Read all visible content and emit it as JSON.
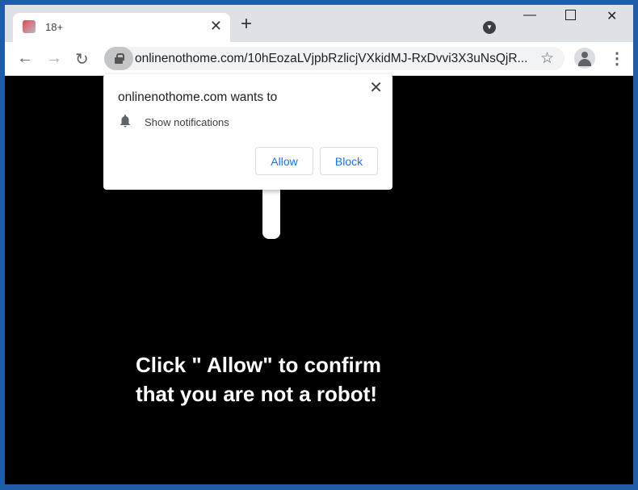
{
  "tab": {
    "title": "18+"
  },
  "toolbar": {
    "url": "onlinenothome.com/10hEozaLVjpbRzlicjVXkidMJ-RxDvvi3X3uNsQjR..."
  },
  "popup": {
    "title": "onlinenothome.com wants to",
    "permission": "Show notifications",
    "allow": "Allow",
    "block": "Block"
  },
  "page": {
    "line1": "Click \" Allow\" to confirm",
    "line2": "that you are not a robot!"
  },
  "colors": {
    "accent": "#1a73e8",
    "frame": "#1f5ba6"
  }
}
